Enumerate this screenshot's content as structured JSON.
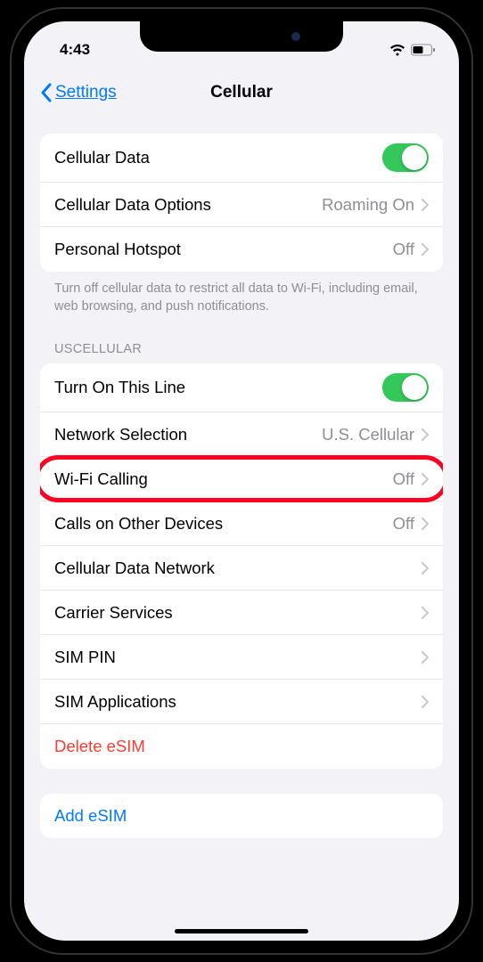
{
  "status": {
    "time": "4:43"
  },
  "nav": {
    "back": "Settings",
    "title": "Cellular"
  },
  "group1": {
    "items": [
      {
        "label": "Cellular Data",
        "toggle": true
      },
      {
        "label": "Cellular Data Options",
        "value": "Roaming On"
      },
      {
        "label": "Personal Hotspot",
        "value": "Off"
      }
    ],
    "footer": "Turn off cellular data to restrict all data to Wi-Fi, including email, web browsing, and push notifications."
  },
  "section2": {
    "header": "USCELLULAR",
    "items": [
      {
        "label": "Turn On This Line",
        "toggle": true
      },
      {
        "label": "Network Selection",
        "value": "U.S. Cellular"
      },
      {
        "label": "Wi-Fi Calling",
        "value": "Off",
        "highlighted": true
      },
      {
        "label": "Calls on Other Devices",
        "value": "Off"
      },
      {
        "label": "Cellular Data Network"
      },
      {
        "label": "Carrier Services"
      },
      {
        "label": "SIM PIN"
      },
      {
        "label": "SIM Applications"
      },
      {
        "label": "Delete eSIM",
        "destructive": true,
        "no_chevron": true
      }
    ]
  },
  "group3": {
    "items": [
      {
        "label": "Add eSIM",
        "link": true,
        "no_chevron": true
      }
    ]
  }
}
